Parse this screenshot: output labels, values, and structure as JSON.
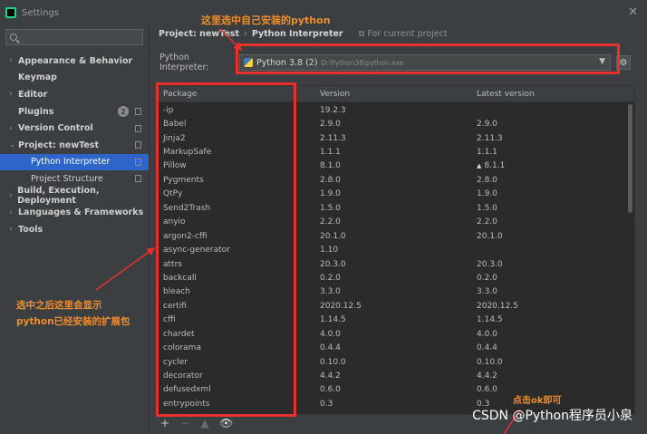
{
  "window": {
    "title": "Settings",
    "close_glyph": "✕"
  },
  "sidebar": {
    "search_placeholder": "",
    "items": [
      {
        "label": "Appearance & Behavior",
        "chevron": "›"
      },
      {
        "label": "Keymap",
        "chevron": ""
      },
      {
        "label": "Editor",
        "chevron": "›"
      },
      {
        "label": "Plugins",
        "chevron": "",
        "badge": "2"
      },
      {
        "label": "Version Control",
        "chevron": "›"
      },
      {
        "label": "Project: newTest",
        "chevron": "⌄"
      },
      {
        "label": "Python Interpreter"
      },
      {
        "label": "Project Structure"
      },
      {
        "label": "Build, Execution, Deployment",
        "chevron": "›"
      },
      {
        "label": "Languages & Frameworks",
        "chevron": "›"
      },
      {
        "label": "Tools",
        "chevron": "›"
      }
    ]
  },
  "breadcrumb": {
    "project": "Project: newTest",
    "separator": "›",
    "page": "Python Interpreter",
    "scope": "⧉ For current project"
  },
  "interpreter": {
    "label": "Python Interpreter:",
    "name": "Python 3.8 (2)",
    "path": "D:\\Python38\\python.exe",
    "arrow": "▼",
    "settings_glyph": "⚙"
  },
  "table": {
    "columns": [
      "Package",
      "Version",
      "Latest version"
    ],
    "rows": [
      [
        "-ip",
        "19.2.3",
        ""
      ],
      [
        "Babel",
        "2.9.0",
        "2.9.0"
      ],
      [
        "Jinja2",
        "2.11.3",
        "2.11.3"
      ],
      [
        "MarkupSafe",
        "1.1.1",
        "1.1.1"
      ],
      [
        "Pillow",
        "8.1.0",
        "8.1.1"
      ],
      [
        "Pygments",
        "2.8.0",
        "2.8.0"
      ],
      [
        "QtPy",
        "1.9.0",
        "1.9.0"
      ],
      [
        "Send2Trash",
        "1.5.0",
        "1.5.0"
      ],
      [
        "anyio",
        "2.2.0",
        "2.2.0"
      ],
      [
        "argon2-cffi",
        "20.1.0",
        "20.1.0"
      ],
      [
        "async-generator",
        "1.10",
        ""
      ],
      [
        "attrs",
        "20.3.0",
        "20.3.0"
      ],
      [
        "backcall",
        "0.2.0",
        "0.2.0"
      ],
      [
        "bleach",
        "3.3.0",
        "3.3.0"
      ],
      [
        "certifi",
        "2020.12.5",
        "2020.12.5"
      ],
      [
        "cffi",
        "1.14.5",
        "1.14.5"
      ],
      [
        "chardet",
        "4.0.0",
        "4.0.0"
      ],
      [
        "colorama",
        "0.4.4",
        "0.4.4"
      ],
      [
        "cycler",
        "0.10.0",
        "0.10.0"
      ],
      [
        "decorator",
        "4.4.2",
        "4.4.2"
      ],
      [
        "defusedxml",
        "0.6.0",
        "0.6.0"
      ],
      [
        "entrypoints",
        "0.3",
        "0.3"
      ]
    ],
    "upgrade_glyph": "▲"
  },
  "toolbar": {
    "add": "+",
    "remove": "−",
    "upgrade": "▲",
    "show": "👁"
  },
  "annotations": {
    "top": "这里选中自己安装的python",
    "left_line1": "选中之后这里会显示",
    "left_line2": "python已经安装的扩展包",
    "bottom": "点击ok即可"
  },
  "watermark": "CSDN @Python程序员小泉",
  "colors": {
    "annotation_red": "#e8312d",
    "annotation_orange": "#f08d2a",
    "selection_blue": "#2f65ca"
  }
}
